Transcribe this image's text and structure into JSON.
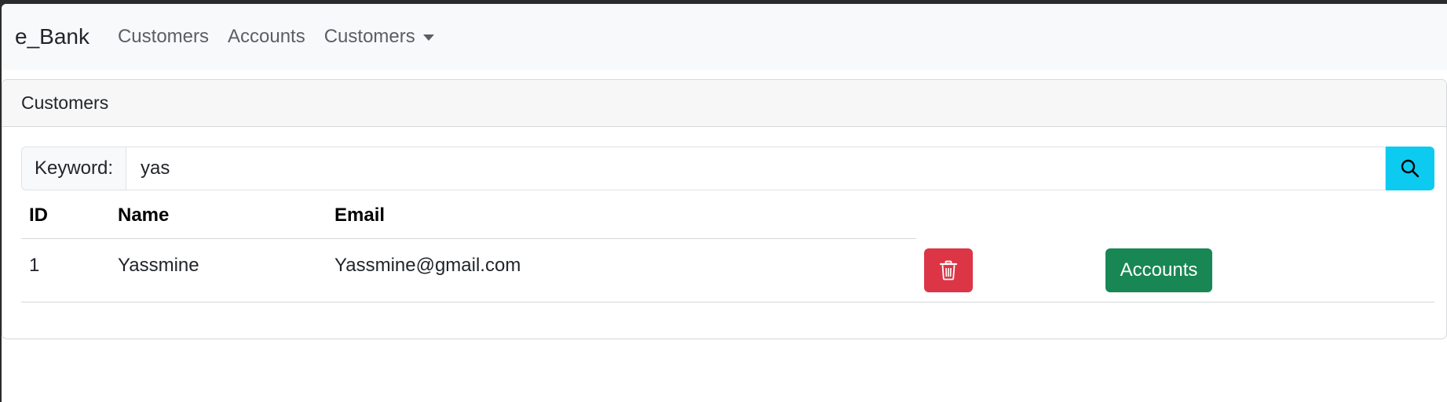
{
  "navbar": {
    "brand": "e_Bank",
    "links": [
      "Customers",
      "Accounts"
    ],
    "dropdown_label": "Customers"
  },
  "card": {
    "header": "Customers"
  },
  "search": {
    "label": "Keyword:",
    "value": "yas",
    "button_icon": "search-icon"
  },
  "table": {
    "columns": [
      "ID",
      "Name",
      "Email"
    ],
    "rows": [
      {
        "id": "1",
        "name": "Yassmine",
        "email": "Yassmine@gmail.com"
      }
    ],
    "row_actions": {
      "delete_icon": "trash-icon",
      "accounts_label": "Accounts"
    }
  },
  "colors": {
    "navbar_bg": "#f8f9fa",
    "search_button": "#0dcaf0",
    "delete_button": "#dc3545",
    "accounts_button": "#198754"
  }
}
